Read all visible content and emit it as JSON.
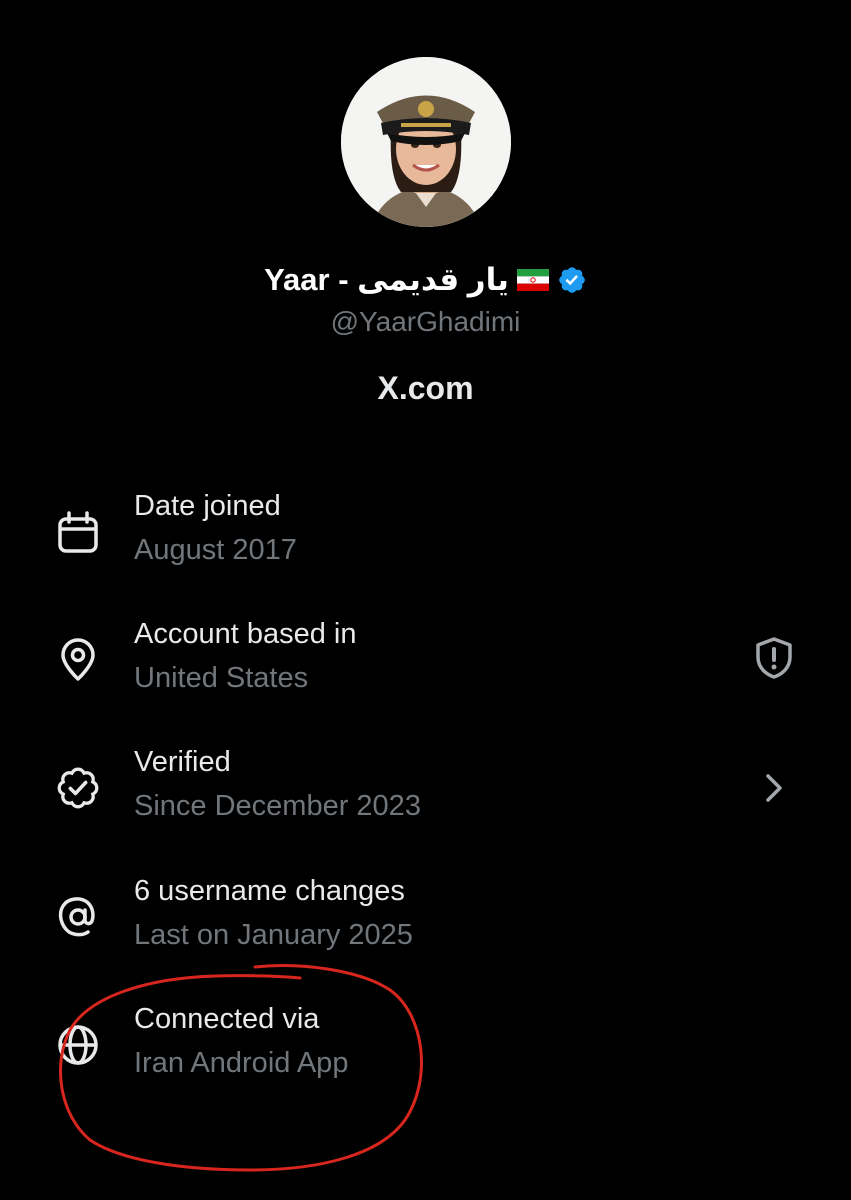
{
  "profile": {
    "display_name": "Yaar - یار قدیمی",
    "flag_icon": "iran-flag-icon",
    "verified_badge_icon": "verified-badge-icon",
    "verified_badge_color": "#1d9bf0",
    "handle": "@YaarGhadimi",
    "site": "X.com"
  },
  "info_rows": [
    {
      "icon": "calendar-icon",
      "title": "Date joined",
      "subtitle": "August 2017"
    },
    {
      "icon": "location-pin-icon",
      "title": "Account based in",
      "subtitle": "United States",
      "right_icon": "shield-alert-icon"
    },
    {
      "icon": "verified-outline-icon",
      "title": "Verified",
      "subtitle": "Since December 2023",
      "right_icon": "chevron-right-icon"
    },
    {
      "icon": "at-sign-icon",
      "title": "6 username changes",
      "subtitle": "Last on January 2025"
    },
    {
      "icon": "globe-icon",
      "title": "Connected via",
      "subtitle": "Iran Android App"
    }
  ],
  "colors": {
    "background": "#000000",
    "primary_text": "#e7e9ea",
    "secondary_text": "#71767b",
    "annotation_circle": "#d7261e"
  }
}
